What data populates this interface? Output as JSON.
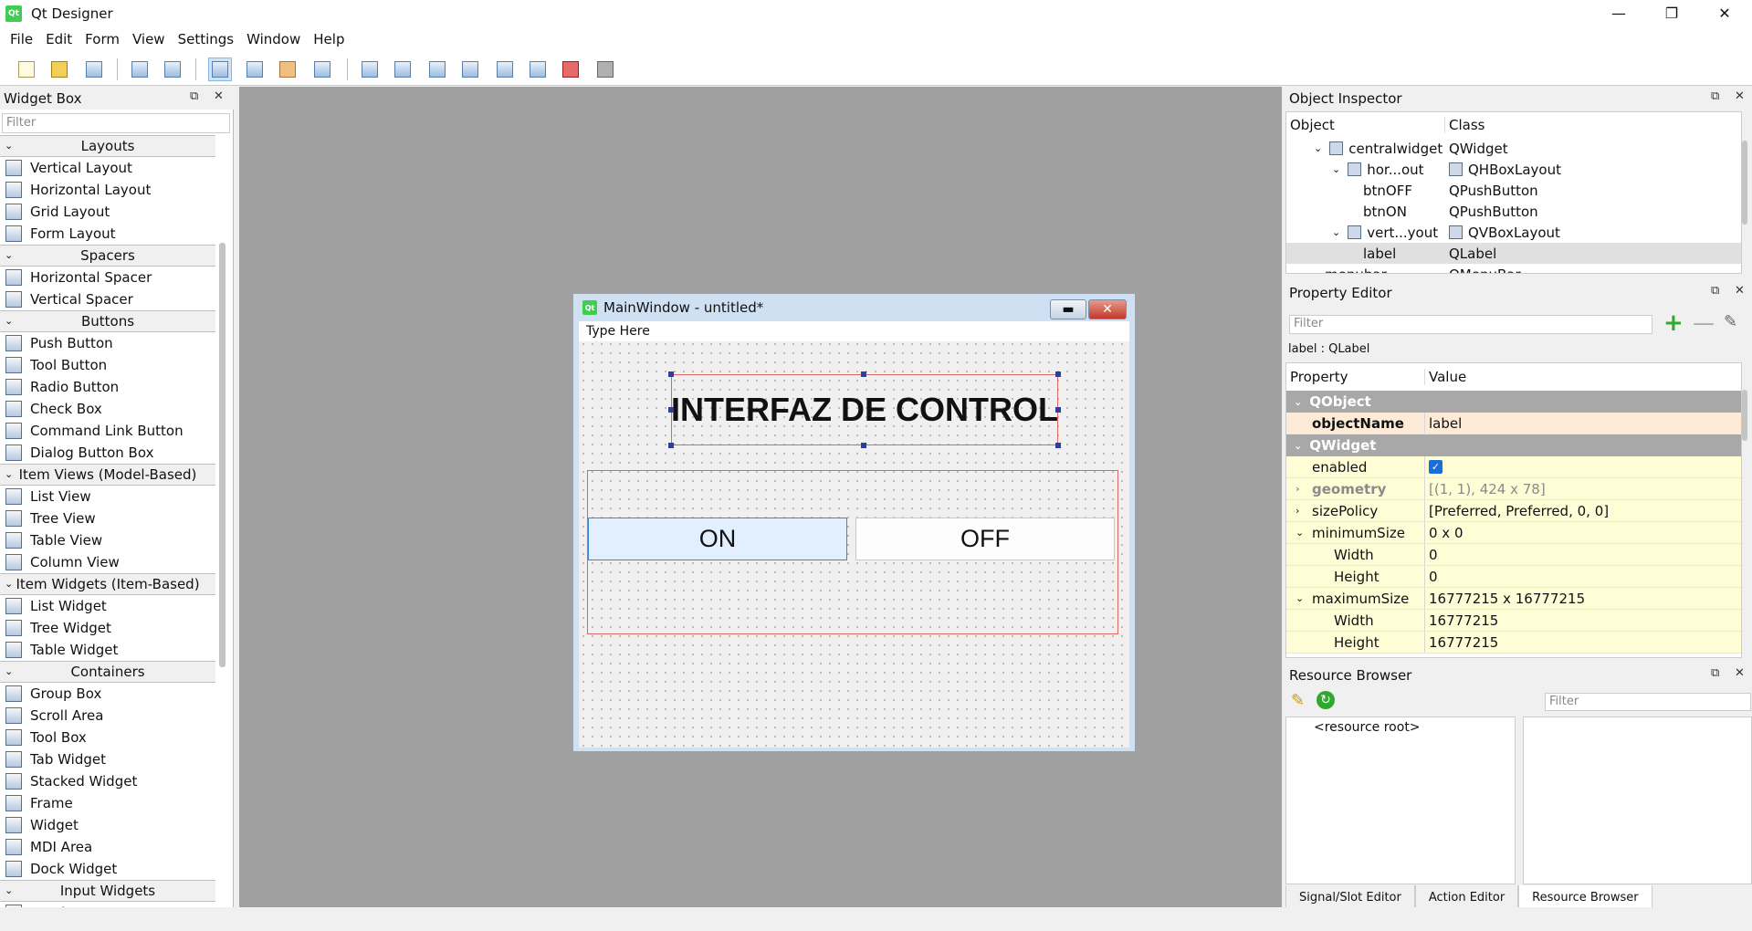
{
  "window": {
    "title": "Qt Designer",
    "app_icon": "Qt"
  },
  "menu": [
    "File",
    "Edit",
    "Form",
    "View",
    "Settings",
    "Window",
    "Help"
  ],
  "toolbar": [
    "new-form",
    "open-form",
    "save-form",
    "send-to-back",
    "bring-to-front",
    "edit-widgets",
    "edit-signals-slots",
    "edit-buddies",
    "edit-tab-order",
    "lay-out-horizontally",
    "lay-out-vertically",
    "lay-out-horizontal-splitter",
    "lay-out-vertical-splitter",
    "lay-out-grid",
    "lay-out-form",
    "break-layout",
    "adjust-size"
  ],
  "widget_box": {
    "title": "Widget Box",
    "filter_placeholder": "Filter",
    "categories": [
      {
        "name": "Layouts",
        "items": [
          "Vertical Layout",
          "Horizontal Layout",
          "Grid Layout",
          "Form Layout"
        ]
      },
      {
        "name": "Spacers",
        "items": [
          "Horizontal Spacer",
          "Vertical Spacer"
        ]
      },
      {
        "name": "Buttons",
        "items": [
          "Push Button",
          "Tool Button",
          "Radio Button",
          "Check Box",
          "Command Link Button",
          "Dialog Button Box"
        ]
      },
      {
        "name": "Item Views (Model-Based)",
        "items": [
          "List View",
          "Tree View",
          "Table View",
          "Column View"
        ]
      },
      {
        "name": "Item Widgets (Item-Based)",
        "items": [
          "List Widget",
          "Tree Widget",
          "Table Widget"
        ]
      },
      {
        "name": "Containers",
        "items": [
          "Group Box",
          "Scroll Area",
          "Tool Box",
          "Tab Widget",
          "Stacked Widget",
          "Frame",
          "Widget",
          "MDI Area",
          "Dock Widget"
        ]
      },
      {
        "name": "Input Widgets",
        "items": [
          "Combo Box"
        ]
      }
    ]
  },
  "form": {
    "title": "MainWindow - untitled*",
    "app_icon": "Qt",
    "menu_placeholder": "Type Here",
    "label_text": "INTERFAZ DE CONTROL",
    "btn_on": "ON",
    "btn_off": "OFF"
  },
  "object_inspector": {
    "title": "Object Inspector",
    "col_object": "Object",
    "col_class": "Class",
    "rows": [
      {
        "object": "centralwidget",
        "class": "QWidget"
      },
      {
        "object": "hor...out",
        "class": "QHBoxLayout"
      },
      {
        "object": "btnOFF",
        "class": "QPushButton"
      },
      {
        "object": "btnON",
        "class": "QPushButton"
      },
      {
        "object": "vert...yout",
        "class": "QVBoxLayout"
      },
      {
        "object": "label",
        "class": "QLabel"
      },
      {
        "object": "menubar",
        "class": "QMenuBar"
      }
    ]
  },
  "property_editor": {
    "title": "Property Editor",
    "filter_placeholder": "Filter",
    "context": "label : QLabel",
    "col_property": "Property",
    "col_value": "Value",
    "group_qobject": "QObject",
    "group_qwidget": "QWidget",
    "rows": [
      {
        "name": "objectName",
        "value": "label"
      },
      {
        "name": "enabled",
        "value": ""
      },
      {
        "name": "geometry",
        "value": "[(1, 1), 424 x 78]"
      },
      {
        "name": "sizePolicy",
        "value": "[Preferred, Preferred, 0, 0]"
      },
      {
        "name": "minimumSize",
        "value": "0 x 0"
      },
      {
        "name": "Width",
        "value": "0"
      },
      {
        "name": "Height",
        "value": "0"
      },
      {
        "name": "maximumSize",
        "value": "16777215 x 16777215"
      },
      {
        "name": "Width",
        "value": "16777215"
      },
      {
        "name": "Height",
        "value": "16777215"
      }
    ]
  },
  "resource_browser": {
    "title": "Resource Browser",
    "filter_placeholder": "Filter",
    "root": "<resource root>"
  },
  "bottom_tabs": [
    "Signal/Slot Editor",
    "Action Editor",
    "Resource Browser"
  ]
}
